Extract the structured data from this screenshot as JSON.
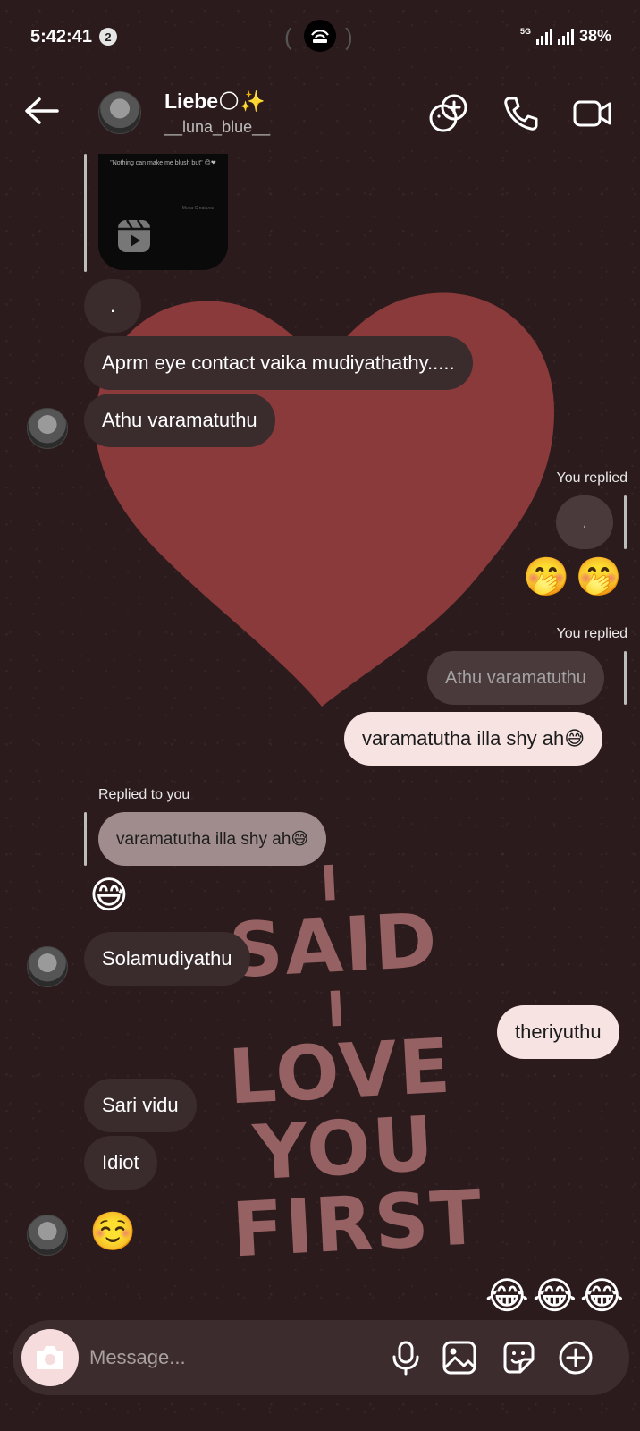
{
  "status": {
    "time": "5:42:41",
    "notification_count": "2",
    "network": "5G",
    "battery": "38%"
  },
  "header": {
    "name": "Liebe🌕✨",
    "username": "__luna_blue__"
  },
  "video_preview": {
    "caption": "\"Nothing can make me blush but\" 😊❤",
    "watermark": "Mona Creations"
  },
  "messages": {
    "m1_dot": ".",
    "m2": "Aprm eye contact vaika mudiyathathy.....",
    "m3": "Athu varamatuthu",
    "you_replied_1": "You replied",
    "quote_1": ".",
    "emoji_1": "🤭🤭",
    "you_replied_2": "You replied",
    "quote_2": "Athu varamatuthu",
    "m4": "varamatutha illa shy ah😅",
    "replied_to_you": "Replied to you",
    "quote_3": "varamatutha illa shy ah😅",
    "emoji_2": "😅",
    "m5": "Solamudiyathu",
    "m6": "theriyuthu",
    "m7": "Sari vidu",
    "m8": "Idiot",
    "emoji_3": "☺️",
    "emoji_4": "😂😂😂"
  },
  "wallpaper": {
    "lines": [
      "I",
      "SAID",
      "I",
      "LOVE",
      "YOU",
      "FIRST"
    ]
  },
  "composer": {
    "placeholder": "Message..."
  },
  "colors": {
    "background": "#2c1b1d",
    "heart": "#8a3a3a",
    "received_bubble": "#3a2b2d",
    "sent_bubble": "#f8e3e3",
    "accent_camera": "#f6dcdc"
  },
  "icons": {
    "back": "back-arrow-icon",
    "add_people": "add-people-icon",
    "call": "phone-icon",
    "video": "video-call-icon",
    "camera": "camera-icon",
    "mic": "microphone-icon",
    "gallery": "gallery-icon",
    "sticker": "sticker-icon",
    "more": "add-circle-icon"
  }
}
